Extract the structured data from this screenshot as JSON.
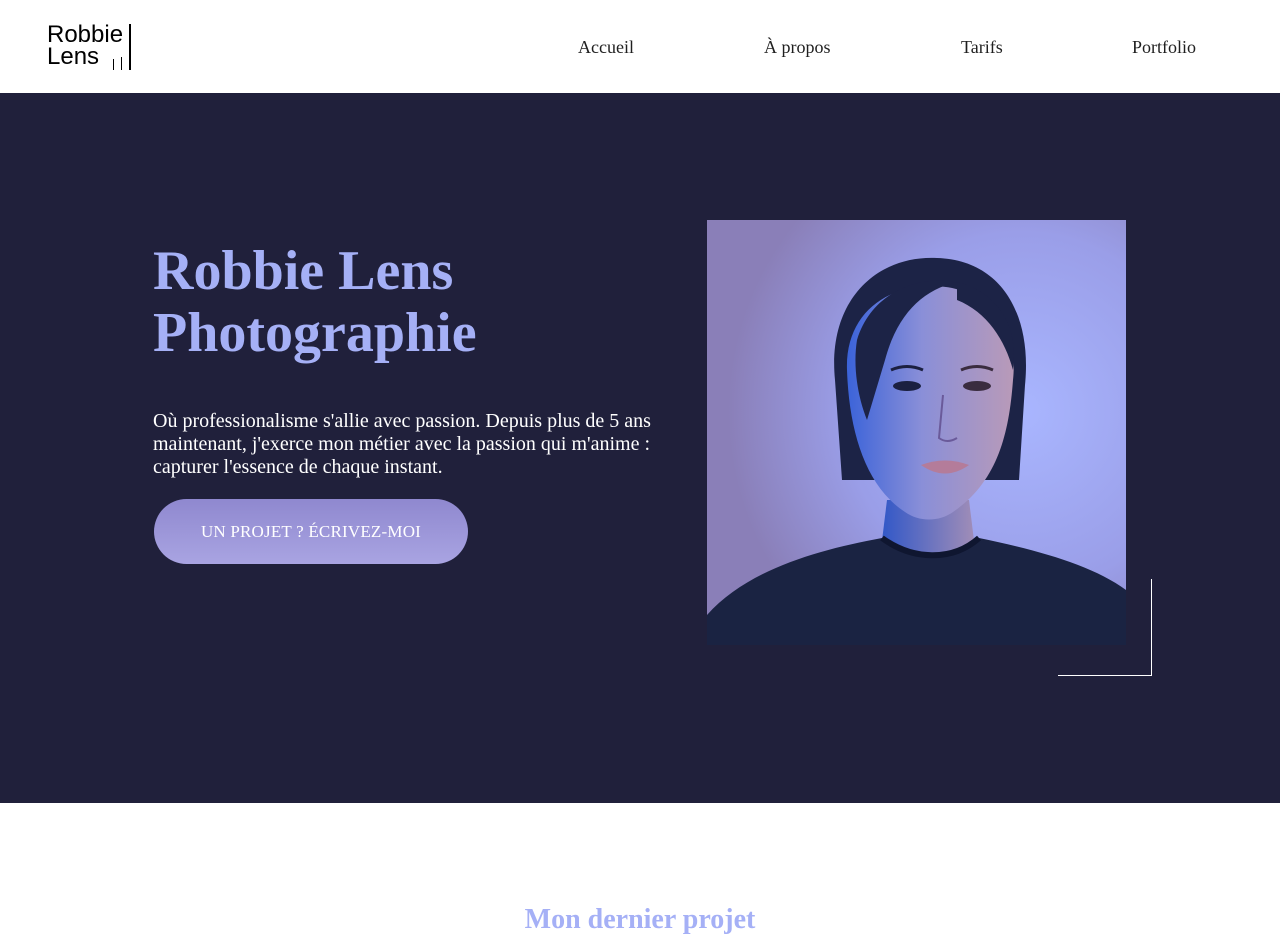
{
  "logo": {
    "line1": "Robbie",
    "line2": "Lens"
  },
  "nav": {
    "items": [
      {
        "label": "Accueil"
      },
      {
        "label": "À propos"
      },
      {
        "label": "Tarifs"
      },
      {
        "label": "Portfolio"
      }
    ]
  },
  "hero": {
    "title_line1": "Robbie Lens",
    "title_line2": "Photographie",
    "text": "Où professionalisme s'allie avec passion. Depuis plus de 5 ans maintenant, j'exerce mon métier avec la passion qui m'anime : capturer l'essence de chaque instant.",
    "cta_label": "UN PROJET ? ÉCRIVEZ-MOI",
    "photo_icon": "portrait-photo"
  },
  "section": {
    "title": "Mon dernier projet"
  },
  "colors": {
    "accent": "#a5b0f6",
    "hero_bg": "#20203b",
    "button": "#9b95d8"
  }
}
